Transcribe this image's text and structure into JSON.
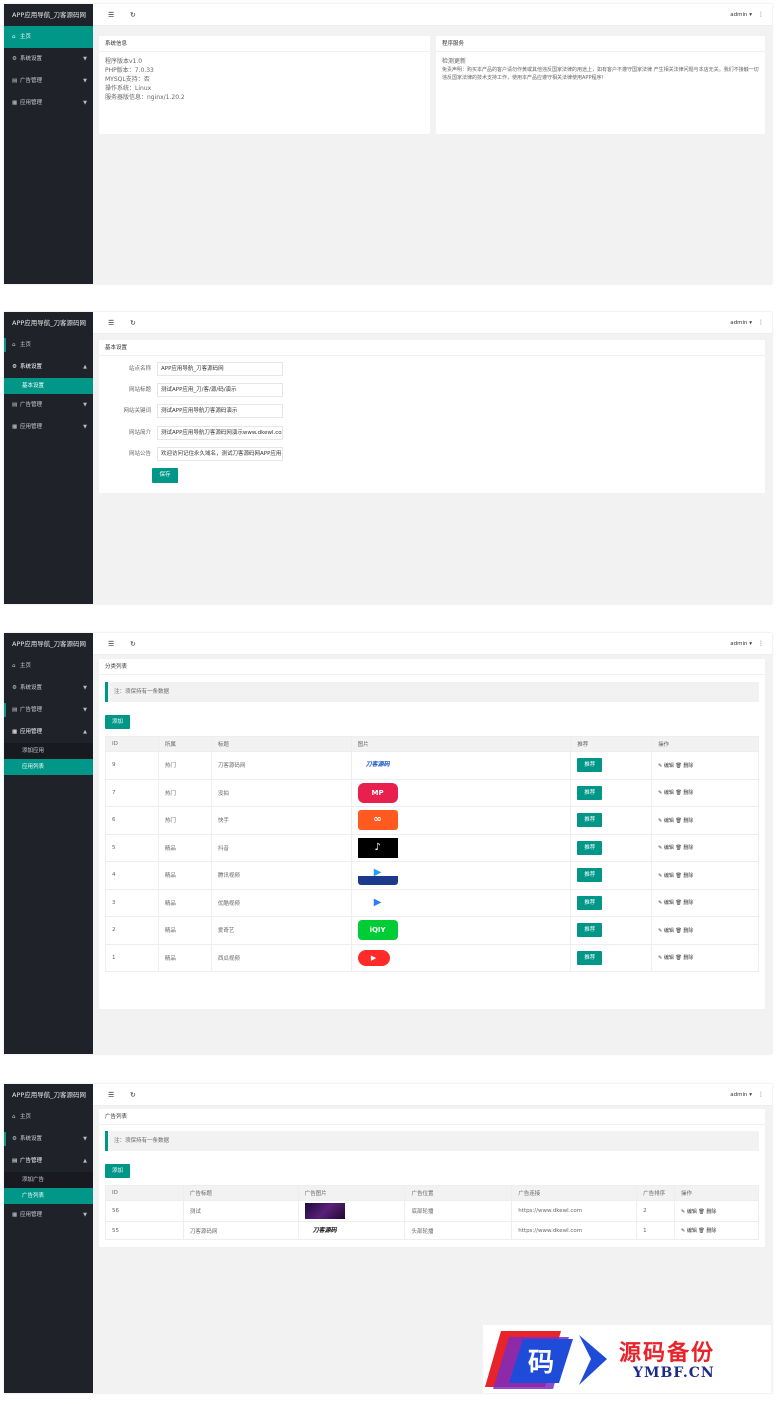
{
  "app_title": "APP应用导航_刀客源码网",
  "nav": {
    "home": "主页",
    "system": "系统设置",
    "ads": "广告管理",
    "apps": "应用管理",
    "basic_settings": "基本设置",
    "add_app": "添加应用",
    "app_list": "应用列表",
    "add_ad": "添加广告",
    "ad_list": "广告列表"
  },
  "topbar": {
    "user": "admin ▾",
    "more": "⋮"
  },
  "panel1": {
    "sys_title": "系统信息",
    "sys_lines": [
      "程序版本v1.0",
      "PHP版本：7.0.33",
      "MYSQL支持：否",
      "操作系统：Linux",
      "服务器版信息：nginx/1.20.2"
    ],
    "svc_title": "程序服务",
    "svc_update": "检测更新",
    "svc_text": "免责声明：购买本产品的客户请勿作黄或其他违反国家法律的用途上，如有客户不遵守国家法律 产生相关法律问题与本店无关。我们不接触一切违反国家法律的技术支持工作，使用本产品应遵守相关法律使用APP程序!"
  },
  "panel2": {
    "title": "基本设置",
    "fields": [
      {
        "label": "站点名称",
        "value": "APP应用导航_刀客源码网"
      },
      {
        "label": "网站标题",
        "value": "测试APP应用_刀/客/源/码/演示"
      },
      {
        "label": "网站关键词",
        "value": "测试APP应用导航刀客源码演示"
      },
      {
        "label": "网站简介",
        "value": "测试APP应用导航刀客源码网演示www.dkewl.com"
      },
      {
        "label": "网站公告",
        "value": "欢迎访问记住永久域名，测试刀客源码网APP应用导"
      }
    ],
    "save": "保存"
  },
  "panel3": {
    "title": "分类列表",
    "note": "注：须保持有一条数据",
    "add": "添加",
    "headers": [
      "ID",
      "所属",
      "标题",
      "图片",
      "推荐",
      "操作"
    ],
    "rows": [
      {
        "id": "9",
        "group": "热门",
        "title": "刀客源码网",
        "logo": "刀客源码",
        "rec": "推荐"
      },
      {
        "id": "7",
        "group": "热门",
        "title": "没拍",
        "logo": "MP",
        "rec": "推荐"
      },
      {
        "id": "6",
        "group": "热门",
        "title": "快手",
        "logo": "∞",
        "rec": "推荐"
      },
      {
        "id": "5",
        "group": "精品",
        "title": "抖音",
        "logo": "♪",
        "rec": "推荐"
      },
      {
        "id": "4",
        "group": "精品",
        "title": "腾讯视频",
        "logo": "▶",
        "rec": "推荐"
      },
      {
        "id": "3",
        "group": "精品",
        "title": "优酷视频",
        "logo": "▶",
        "rec": "推荐"
      },
      {
        "id": "2",
        "group": "精品",
        "title": "爱奇艺",
        "logo": "iQIY",
        "rec": "推荐"
      },
      {
        "id": "1",
        "group": "精品",
        "title": "西瓜视频",
        "logo": "▶",
        "rec": "推荐"
      }
    ],
    "ops": "✎ 编辑 🗑 删除"
  },
  "panel4": {
    "title": "广告列表",
    "note": "注：须保持有一条数据",
    "add": "添加",
    "headers": [
      "ID",
      "广告标题",
      "广告图片",
      "广告位置",
      "广告连接",
      "广告排序",
      "操作"
    ],
    "rows": [
      {
        "id": "56",
        "title": "测试",
        "pos": "底部轮播",
        "link": "https://www.dkewl.com",
        "sort": "2"
      },
      {
        "id": "55",
        "title": "刀客源码网",
        "pos": "头部轮播",
        "link": "https://www.dkewl.com",
        "sort": "1"
      }
    ],
    "ops": "✎ 编辑 🗑 删除"
  },
  "watermark": {
    "cn": "源码备份",
    "en": "YMBF.CN",
    "glyph": "码"
  },
  "colors": {
    "accent": "#009688",
    "sidebar": "#20222a"
  }
}
